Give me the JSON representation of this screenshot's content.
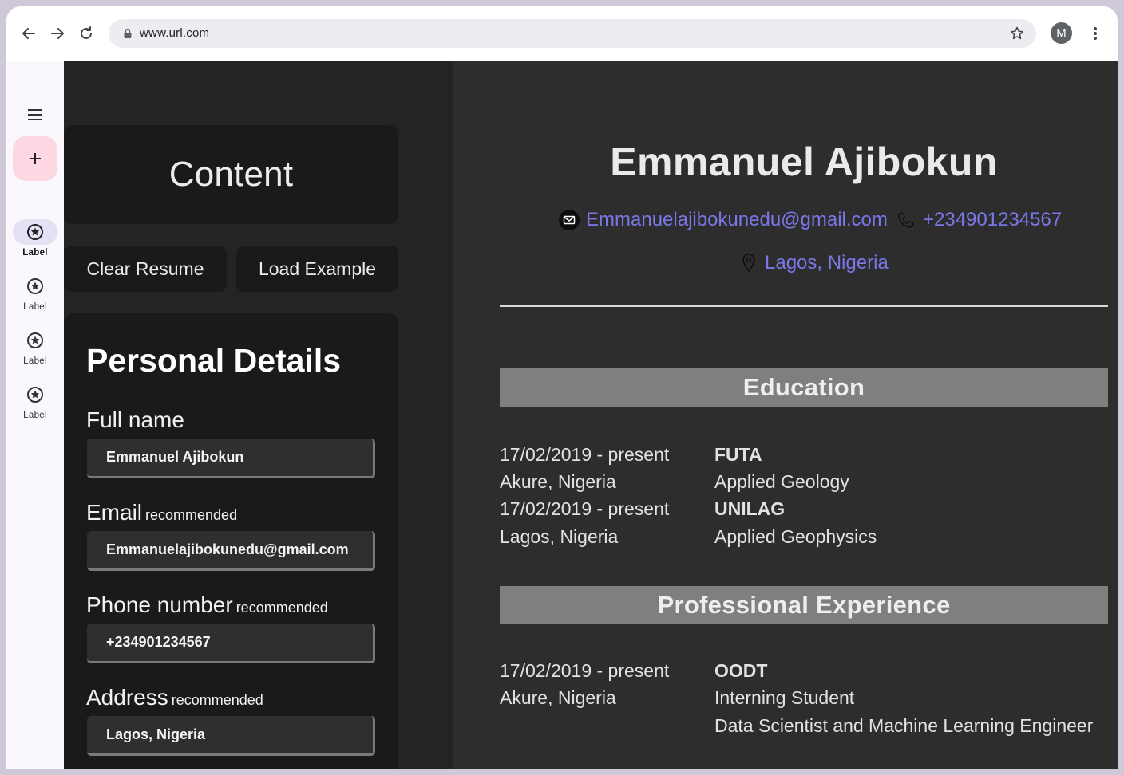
{
  "browser": {
    "url": "www.url.com",
    "profile_initial": "M"
  },
  "rail": {
    "items": [
      {
        "label": "Label"
      },
      {
        "label": "Label"
      },
      {
        "label": "Label"
      },
      {
        "label": "Label"
      }
    ]
  },
  "editor": {
    "content_title": "Content",
    "clear_label": "Clear Resume",
    "load_label": "Load Example",
    "section_heading": "Personal Details",
    "fields": {
      "full_name": {
        "label": "Full name",
        "value": "Emmanuel Ajibokun"
      },
      "email": {
        "label": "Email",
        "tag": "recommended",
        "value": "Emmanuelajibokunedu@gmail.com"
      },
      "phone": {
        "label": "Phone number",
        "tag": "recommended",
        "value": "+234901234567"
      },
      "address": {
        "label": "Address",
        "tag": "recommended",
        "value": "Lagos, Nigeria"
      }
    }
  },
  "preview": {
    "name": "Emmanuel Ajibokun",
    "email": "Emmanuelajibokunedu@gmail.com",
    "phone": "+234901234567",
    "location": "Lagos, Nigeria",
    "link_color": "#7a78e8",
    "education": {
      "title": "Education",
      "entries": [
        {
          "date": "17/02/2019 - present",
          "place": "Akure, Nigeria",
          "school": "FUTA",
          "degree": "Applied Geology"
        },
        {
          "date": "17/02/2019 - present",
          "place": "Lagos, Nigeria",
          "school": "UNILAG",
          "degree": "Applied Geophysics"
        }
      ]
    },
    "experience": {
      "title": "Professional Experience",
      "entries": [
        {
          "date": "17/02/2019 - present",
          "place": "Akure, Nigeria",
          "company": "OODT",
          "position": "Interning Student",
          "description": "Data Scientist and Machine Learning Engineer"
        }
      ]
    }
  }
}
